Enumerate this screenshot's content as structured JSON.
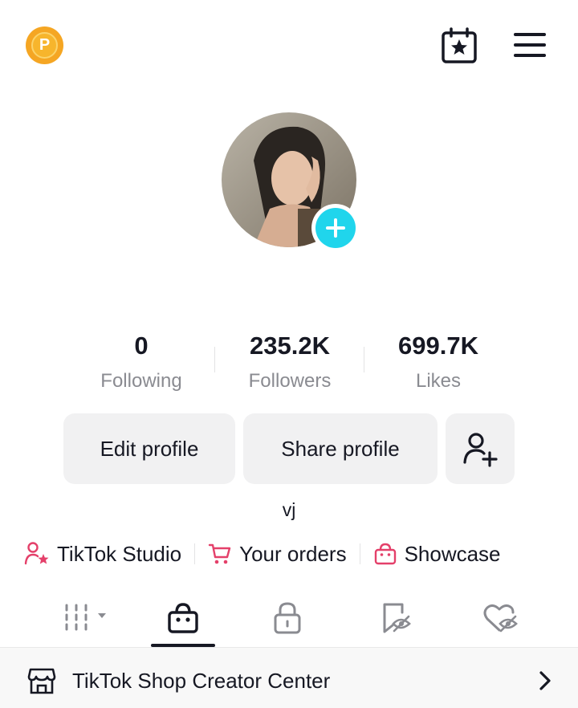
{
  "header": {
    "coin_letter": "P",
    "calendar_icon": "calendar-star-icon",
    "menu_icon": "hamburger-menu-icon"
  },
  "profile": {
    "avatar_alt": "profile photo",
    "add_icon": "plus-icon",
    "username": "vj"
  },
  "stats": [
    {
      "value": "0",
      "label": "Following"
    },
    {
      "value": "235.2K",
      "label": "Followers"
    },
    {
      "value": "699.7K",
      "label": "Likes"
    }
  ],
  "buttons": {
    "edit_profile": "Edit profile",
    "share_profile": "Share profile",
    "add_friend_icon": "add-friend-icon"
  },
  "links": [
    {
      "label": "TikTok Studio",
      "icon": "studio-icon"
    },
    {
      "label": "Your orders",
      "icon": "cart-icon"
    },
    {
      "label": "Showcase",
      "icon": "shopping-bag-icon"
    }
  ],
  "tabs": [
    {
      "icon": "videos-grid-icon",
      "active": false
    },
    {
      "icon": "shop-bag-icon",
      "active": true
    },
    {
      "icon": "lock-icon",
      "active": false
    },
    {
      "icon": "saved-icon",
      "active": false
    },
    {
      "icon": "liked-icon",
      "active": false
    }
  ],
  "shop_bar": {
    "label": "TikTok Shop Creator Center",
    "icon": "storefront-icon"
  },
  "colors": {
    "accent_teal": "#20d5ec",
    "link_pink": "#fe2c55",
    "coin": "#f5a623"
  }
}
